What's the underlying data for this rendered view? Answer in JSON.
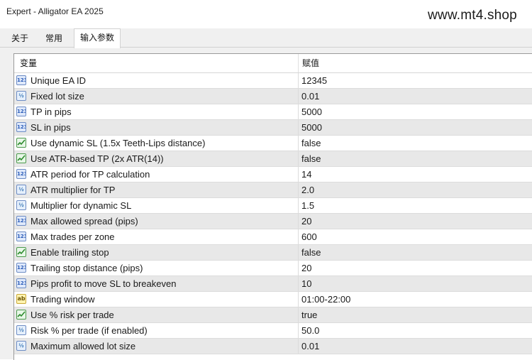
{
  "window": {
    "title": "Expert - Alligator EA 2025",
    "watermark": "www.mt4.shop"
  },
  "tabs": [
    {
      "label": "关于",
      "active": false
    },
    {
      "label": "常用",
      "active": false
    },
    {
      "label": "输入参数",
      "active": true
    }
  ],
  "table": {
    "headers": {
      "variable": "变量",
      "value": "赋值"
    },
    "rows": [
      {
        "type": "int",
        "icon": "int-type-icon",
        "name": "Unique EA ID",
        "value": "12345"
      },
      {
        "type": "double",
        "icon": "double-type-icon",
        "name": "Fixed lot size",
        "value": "0.01"
      },
      {
        "type": "int",
        "icon": "int-type-icon",
        "name": "TP in pips",
        "value": "5000"
      },
      {
        "type": "int",
        "icon": "int-type-icon",
        "name": "SL in pips",
        "value": "5000"
      },
      {
        "type": "bool",
        "icon": "bool-type-icon",
        "name": "Use dynamic SL (1.5x Teeth-Lips distance)",
        "value": "false"
      },
      {
        "type": "bool",
        "icon": "bool-type-icon",
        "name": "Use ATR-based TP (2x ATR(14))",
        "value": "false"
      },
      {
        "type": "int",
        "icon": "int-type-icon",
        "name": "ATR period for TP calculation",
        "value": "14"
      },
      {
        "type": "double",
        "icon": "double-type-icon",
        "name": "ATR multiplier for TP",
        "value": "2.0"
      },
      {
        "type": "double",
        "icon": "double-type-icon",
        "name": "Multiplier for dynamic SL",
        "value": "1.5"
      },
      {
        "type": "int",
        "icon": "int-type-icon",
        "name": "Max allowed spread (pips)",
        "value": "20"
      },
      {
        "type": "int",
        "icon": "int-type-icon",
        "name": "Max trades per zone",
        "value": "600"
      },
      {
        "type": "bool",
        "icon": "bool-type-icon",
        "name": "Enable trailing stop",
        "value": "false"
      },
      {
        "type": "int",
        "icon": "int-type-icon",
        "name": "Trailing stop distance (pips)",
        "value": "20"
      },
      {
        "type": "int",
        "icon": "int-type-icon",
        "name": "Pips profit to move SL to breakeven",
        "value": "10"
      },
      {
        "type": "string",
        "icon": "string-type-icon",
        "name": "Trading window",
        "value": "01:00-22:00"
      },
      {
        "type": "bool",
        "icon": "bool-type-icon",
        "name": "Use % risk per trade",
        "value": "true"
      },
      {
        "type": "double",
        "icon": "double-type-icon",
        "name": "Risk % per trade (if enabled)",
        "value": "50.0"
      },
      {
        "type": "double",
        "icon": "double-type-icon",
        "name": "Maximum allowed lot size",
        "value": "0.01"
      }
    ]
  }
}
